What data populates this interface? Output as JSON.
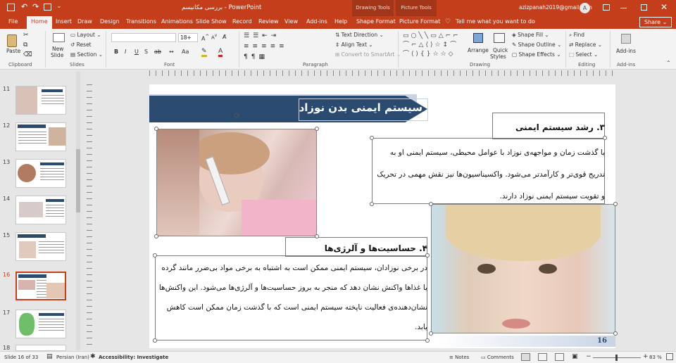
{
  "titlebar": {
    "filename": "بررسی مکانیسم",
    "sep": "-",
    "app": "PowerPoint",
    "context_drawing": "Drawing Tools",
    "context_picture": "Picture Tools",
    "email": "azizpanah2019@gmail.com",
    "avatar": "A"
  },
  "tabs": [
    "File",
    "Home",
    "Insert",
    "Draw",
    "Design",
    "Transitions",
    "Animations",
    "Slide Show",
    "Record",
    "Review",
    "View",
    "Add-ins",
    "Help",
    "Shape Format",
    "Picture Format"
  ],
  "tellme": "Tell me what you want to do",
  "share": "Share",
  "ribbon": {
    "clipboard": {
      "paste": "Paste",
      "label": "Clipboard"
    },
    "slides": {
      "new_slide": "New",
      "new_slide2": "Slide",
      "layout": "Layout",
      "reset": "Reset",
      "section": "Section",
      "label": "Slides"
    },
    "font": {
      "size": "18+",
      "label": "Font",
      "bold": "B",
      "italic": "I",
      "underline": "U",
      "strike": "S",
      "shadow": "ab"
    },
    "paragraph": {
      "text_direction": "Text Direction",
      "align_text": "Align Text",
      "smartart": "Convert to SmartArt",
      "label": "Paragraph"
    },
    "drawing": {
      "arrange": "Arrange",
      "quick_styles": "Quick",
      "quick_styles2": "Styles",
      "shape_fill": "Shape Fill",
      "shape_outline": "Shape Outline",
      "shape_effects": "Shape Effects",
      "label": "Drawing"
    },
    "editing": {
      "find": "Find",
      "replace": "Replace",
      "select": "Select",
      "label": "Editing"
    },
    "addins": {
      "addins": "Add-ins",
      "label": "Add-ins"
    }
  },
  "thumbnails": [
    {
      "num": "11",
      "selected": false
    },
    {
      "num": "12",
      "selected": false
    },
    {
      "num": "13",
      "selected": false
    },
    {
      "num": "14",
      "selected": false
    },
    {
      "num": "15",
      "selected": false
    },
    {
      "num": "16",
      "selected": true
    },
    {
      "num": "17",
      "selected": false
    },
    {
      "num": "18",
      "selected": false
    }
  ],
  "slide": {
    "title": "سیستم ایمنی بدن نوزاد",
    "heading3": "۳. رشد سیستم ایمنی",
    "body3": "با گذشت زمان و مواجهه‌ی نوزاد با عوامل محیطی، سیستم ایمنی او به تدریج قوی‌تر و کارآمدتر می‌شود. واکسیناسیون‌ها نیز نقش مهمی در تحریک و تقویت سیستم ایمنی نوزاد دارند.",
    "heading4": "۴. حساسیت‌ها و آلرژی‌ها",
    "body4": "در برخی نوزادان، سیستم ایمنی ممکن است به اشتباه به برخی مواد بی‌ضرر مانند گرده یا غذاها واکنش نشان دهد که منجر به بروز حساسیت‌ها و آلرژی‌ها می‌شود. این واکنش‌ها نشان‌دهنده‌ی فعالیت ناپخته سیستم ایمنی است که با گذشت زمان ممکن است کاهش یابد.",
    "page_number": "16"
  },
  "status": {
    "slide_of": "Slide 16 of 33",
    "language": "Persian (Iran)",
    "accessibility": "Accessibility: Investigate",
    "notes": "Notes",
    "comments": "Comments",
    "zoom": "83 %"
  },
  "colors": {
    "accent": "#c43e1c",
    "title_bg": "#2b4a6f",
    "light_bar": "#c9d3e4"
  }
}
